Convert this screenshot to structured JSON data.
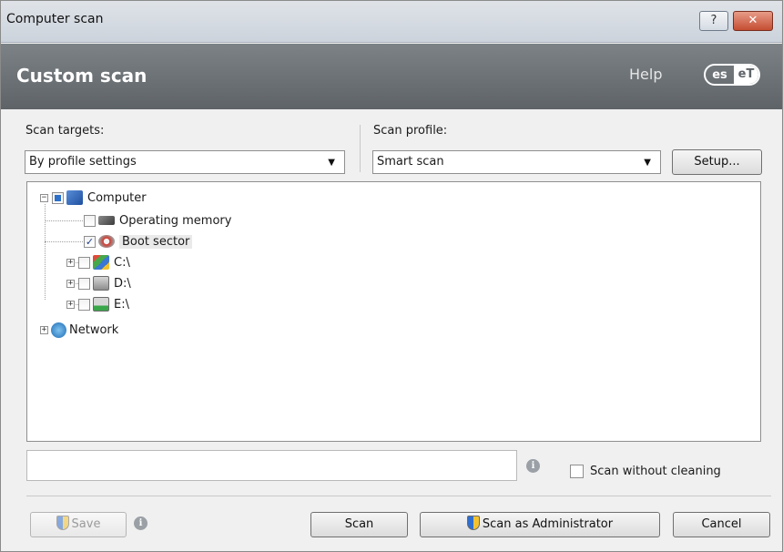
{
  "window": {
    "title": "Computer scan",
    "help_btn": "?",
    "close_btn": "✕"
  },
  "header": {
    "title": "Custom scan",
    "help": "Help",
    "logo_left": "es",
    "logo_right": "eT"
  },
  "scan_targets": {
    "label": "Scan targets:",
    "value": "By profile settings"
  },
  "scan_profile": {
    "label": "Scan profile:",
    "value": "Smart scan",
    "setup": "Setup..."
  },
  "tree": [
    {
      "label": "Computer",
      "icon": "computer-icon",
      "checkbox": "partial"
    },
    {
      "label": "Operating memory",
      "icon": "memory-chip-icon",
      "checkbox": "unchecked"
    },
    {
      "label": "Boot sector",
      "icon": "disk-icon",
      "checkbox": "checked",
      "selected": true
    },
    {
      "label": "C:\\",
      "icon": "system-drive-icon",
      "checkbox": "unchecked"
    },
    {
      "label": "D:\\",
      "icon": "cd-drive-icon",
      "checkbox": "unchecked"
    },
    {
      "label": "E:\\",
      "icon": "network-drive-icon",
      "checkbox": "unchecked"
    },
    {
      "label": "Network",
      "icon": "network-globe-icon"
    }
  ],
  "path_input": {
    "value": ""
  },
  "options": {
    "scan_without_cleaning": "Scan without cleaning"
  },
  "buttons": {
    "save": "Save",
    "scan": "Scan",
    "scan_admin": "Scan as Administrator",
    "cancel": "Cancel"
  },
  "colors": {
    "header_bg": "#6b7074",
    "accent": "#2c70c9"
  }
}
